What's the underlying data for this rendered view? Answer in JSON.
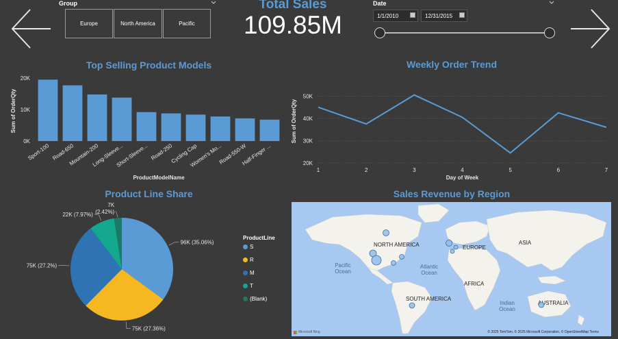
{
  "group_slicer": {
    "title": "Group",
    "items": [
      "Europe",
      "North America",
      "Pacific"
    ]
  },
  "kpi": {
    "title": "Total Sales",
    "value": "109.85M"
  },
  "date_slicer": {
    "title": "Date",
    "start": "1/1/2010",
    "end": "12/31/2015"
  },
  "bar_chart": {
    "title": "Top Selling Product Models",
    "chart_data": {
      "type": "bar",
      "categories": [
        "Sport-100",
        "Road-650",
        "Mountain-200",
        "Long-Sleeve...",
        "Short-Sleeve...",
        "Road-250",
        "Cycling Cap",
        "Women's Mo...",
        "Road-550-W",
        "Half-Finger ..."
      ],
      "values": [
        19500,
        17700,
        14800,
        13800,
        9200,
        8800,
        8400,
        7800,
        7200,
        6800
      ],
      "xlabel": "ProductModelName",
      "ylabel": "Sum of OrderQty",
      "ylim": [
        0,
        20000
      ],
      "yticks": [
        "0K",
        "10K",
        "20K"
      ]
    }
  },
  "line_chart": {
    "title": "Weekly Order Trend",
    "chart_data": {
      "type": "line",
      "x": [
        1,
        2,
        3,
        4,
        5,
        6,
        7
      ],
      "values": [
        45000,
        37500,
        50500,
        40500,
        24500,
        42500,
        36000
      ],
      "xlabel": "Day of Week",
      "ylabel": "Sum of OrderQty",
      "ylim": [
        20000,
        55000
      ],
      "yticks": [
        "20K",
        "30K",
        "40K",
        "50K"
      ],
      "color": "#5b9bd5"
    }
  },
  "pie_chart": {
    "title": "Product Line Share",
    "chart_data": {
      "type": "pie",
      "legend_title": "ProductLine",
      "slices": [
        {
          "name": "S",
          "value": 96000,
          "pct": 35.06,
          "label": "96K (35.06%)",
          "color": "#5b9bd5"
        },
        {
          "name": "R",
          "value": 75000,
          "pct": 27.36,
          "label": "75K (27.36%)",
          "color": "#f5b820"
        },
        {
          "name": "M",
          "value": 75000,
          "pct": 27.2,
          "label": "75K (27.2%)",
          "color": "#2e74b5"
        },
        {
          "name": "T",
          "value": 22000,
          "pct": 7.97,
          "label": "22K (7.97%)",
          "color": "#14a98f"
        },
        {
          "name": "(Blank)",
          "value": 7000,
          "pct": 2.42,
          "label": "7K (2.42%)",
          "color": "#1a7a66"
        }
      ],
      "top_label_value": "7K",
      "top_label_pct": "(2.42%)"
    }
  },
  "map": {
    "title": "Sales Revenue by Region",
    "labels": {
      "north_america": "NORTH AMERICA",
      "europe": "EUROPE",
      "asia": "ASIA",
      "africa": "AFRICA",
      "south_america": "SOUTH AMERICA",
      "australia": "AUSTRALIA",
      "pacific_ocean": "Pacific Ocean",
      "atlantic_ocean": "Atlantic Ocean",
      "indian_ocean": "Indian Ocean"
    },
    "attribution": "© 2025 TomTom, © 2025 Microsoft Corporation, © OpenStreetMap  Terms",
    "bing": "Microsoft Bing"
  }
}
